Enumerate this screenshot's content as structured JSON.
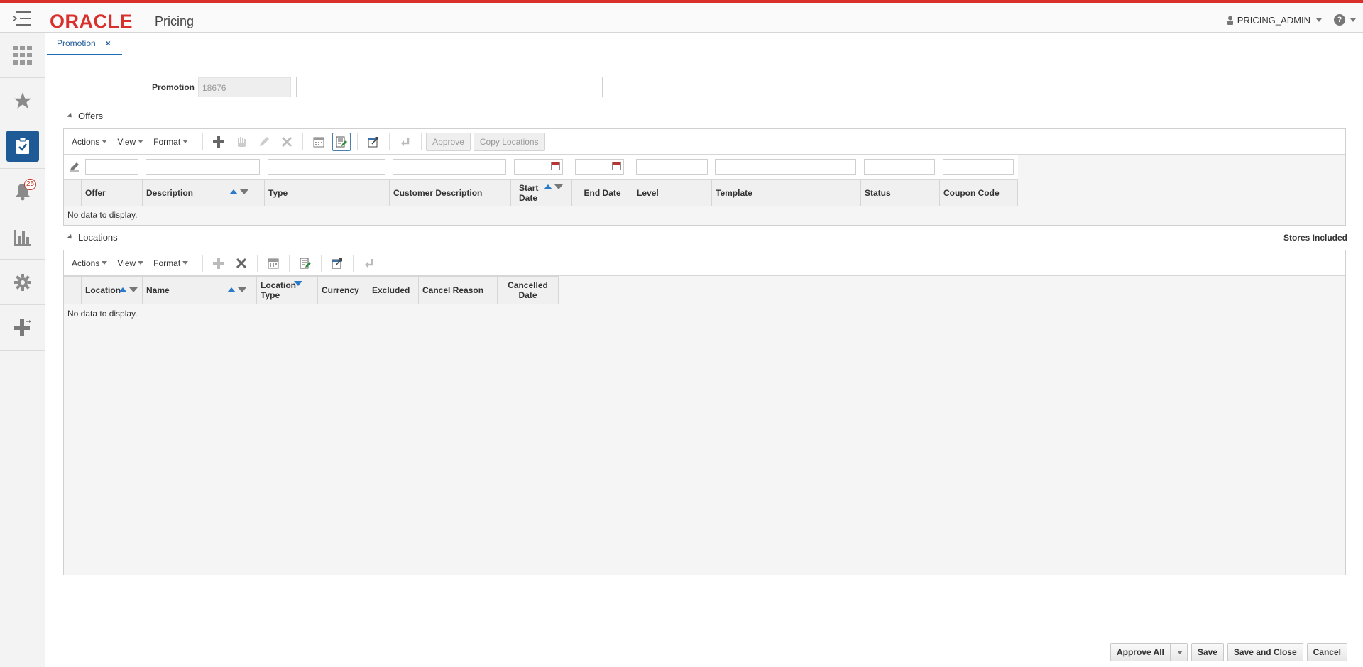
{
  "app": {
    "brand": "ORACLE",
    "app_name": "Pricing"
  },
  "user": {
    "name": "PRICING_ADMIN"
  },
  "help": {
    "glyph": "?"
  },
  "sidebar": {
    "notification_count": "25"
  },
  "tab": {
    "label": "Promotion",
    "close": "×"
  },
  "promotion": {
    "label": "Promotion",
    "id": "18676",
    "description": ""
  },
  "offers": {
    "title": "Offers",
    "toolbar": {
      "actions": "Actions",
      "view": "View",
      "format": "Format",
      "approve": "Approve",
      "copy_locations": "Copy Locations"
    },
    "columns": {
      "offer": "Offer",
      "description": "Description",
      "type": "Type",
      "customer_description": "Customer Description",
      "start_date_1": "Start",
      "start_date_2": "Date",
      "end_date": "End Date",
      "level": "Level",
      "template": "Template",
      "status": "Status",
      "coupon_code": "Coupon Code"
    },
    "empty": "No data to display."
  },
  "locations": {
    "title": "Locations",
    "stores_included": "Stores Included",
    "toolbar": {
      "actions": "Actions",
      "view": "View",
      "format": "Format"
    },
    "columns": {
      "location": "Location",
      "name": "Name",
      "location_type_1": "Location",
      "location_type_2": "Type",
      "currency": "Currency",
      "excluded": "Excluded",
      "cancel_reason": "Cancel Reason",
      "cancelled_date_1": "Cancelled",
      "cancelled_date_2": "Date"
    },
    "empty": "No data to display."
  },
  "footer": {
    "approve_all": "Approve All",
    "save": "Save",
    "save_and_close": "Save and Close",
    "cancel": "Cancel"
  },
  "colors": {
    "brand_red": "#d9302c",
    "accent_blue": "#1e5b96",
    "sort_blue": "#2a7ac7"
  }
}
